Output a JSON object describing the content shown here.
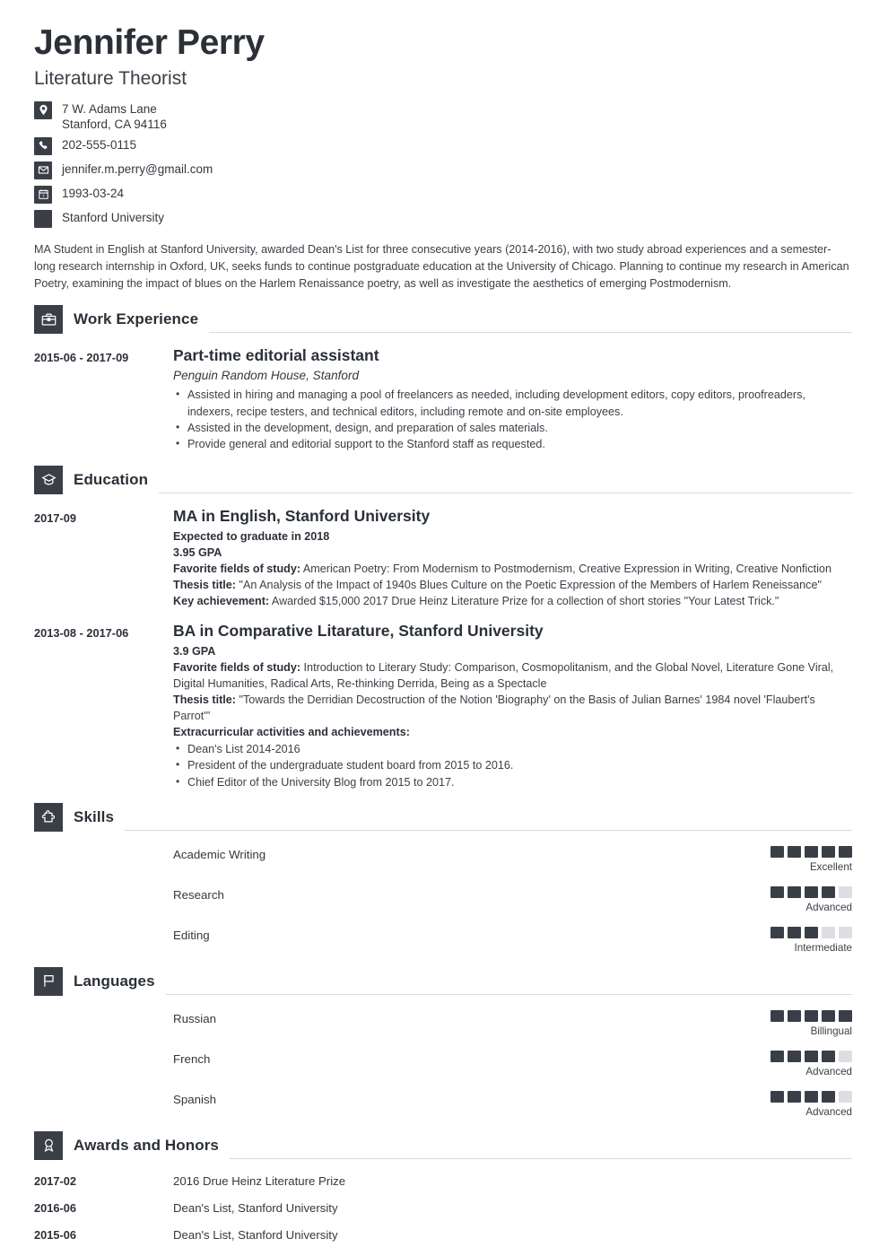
{
  "header": {
    "name": "Jennifer Perry",
    "job_title": "Literature Theorist",
    "contacts": [
      {
        "icon": "location-pin-icon",
        "line1": "7 W. Adams Lane",
        "line2": "Stanford, CA 94116"
      },
      {
        "icon": "phone-icon",
        "line1": "202-555-0115",
        "line2": ""
      },
      {
        "icon": "envelope-icon",
        "line1": "jennifer.m.perry@gmail.com",
        "line2": ""
      },
      {
        "icon": "calendar-icon",
        "line1": "1993-03-24",
        "line2": ""
      },
      {
        "icon": "square-icon",
        "line1": "Stanford University",
        "line2": ""
      }
    ]
  },
  "summary": "MA Student in English at Stanford University, awarded Dean's List for three consecutive years (2014-2016), with two study abroad experiences and a semester-long research internship in Oxford, UK, seeks funds to continue postgraduate education at the University of Chicago. Planning to continue my research in American Poetry, examining the impact of blues on the Harlem Renaissance poetry, as well as investigate the aesthetics of emerging Postmodernism.",
  "sections": {
    "work": {
      "title": "Work Experience",
      "icon": "briefcase-icon",
      "entries": [
        {
          "date": "2015-06 - 2017-09",
          "title": "Part-time editorial assistant",
          "subtitle": "Penguin Random House, Stanford",
          "bullets": [
            "Assisted in hiring and managing a pool of freelancers as needed, including development editors, copy editors, proofreaders, indexers, recipe testers, and technical editors, including remote and on-site employees.",
            "Assisted in the development, design, and preparation of sales materials.",
            "Provide general and editorial support to the Stanford staff as requested."
          ]
        }
      ]
    },
    "education": {
      "title": "Education",
      "icon": "graduation-cap-icon",
      "entries": [
        {
          "date": "2017-09",
          "title": "MA in English, Stanford University",
          "bold_lines": [
            "Expected to graduate in 2018",
            "3.95 GPA"
          ],
          "details": [
            {
              "label": "Favorite fields of study:",
              "text": " American Poetry: From Modernism to Postmodernism, Creative Expression in Writing, Creative Nonfiction"
            },
            {
              "label": "Thesis title:",
              "text": " \"An Analysis of the Impact of 1940s Blues Culture on the Poetic Expression of the Members of Harlem Reneissance\""
            },
            {
              "label": "Key achievement:",
              "text": " Awarded $15,000 2017 Drue Heinz Literature Prize for a collection of short stories \"Your Latest Trick.\""
            }
          ],
          "bullets_heading": "",
          "bullets": []
        },
        {
          "date": "2013-08 - 2017-06",
          "title": "BA in Comparative Litarature, Stanford University",
          "bold_lines": [
            "3.9 GPA"
          ],
          "details": [
            {
              "label": "Favorite fields of study:",
              "text": " Introduction to Literary Study: Comparison, Cosmopolitanism, and the Global Novel, Literature Gone Viral, Digital Humanities, Radical Arts, Re-thinking Derrida, Being as a Spectacle"
            },
            {
              "label": "Thesis title:",
              "text": " \"Towards the Derridian Decostruction of the Notion 'Biography' on the Basis of Julian Barnes' 1984 novel 'Flaubert's Parrot'\""
            }
          ],
          "bullets_heading": "Extracurricular activities and achievements:",
          "bullets": [
            "Dean's List 2014-2016",
            "President of the undergraduate student board from 2015 to 2016.",
            "Chief Editor of the University Blog from 2015 to 2017."
          ]
        }
      ]
    },
    "skills": {
      "title": "Skills",
      "icon": "puzzle-piece-icon",
      "max_rating": 5,
      "items": [
        {
          "name": "Academic Writing",
          "rating": 5,
          "level": "Excellent"
        },
        {
          "name": "Research",
          "rating": 4,
          "level": "Advanced"
        },
        {
          "name": "Editing",
          "rating": 3,
          "level": "Intermediate"
        }
      ]
    },
    "languages": {
      "title": "Languages",
      "icon": "flag-icon",
      "max_rating": 5,
      "items": [
        {
          "name": "Russian",
          "rating": 5,
          "level": "Billingual"
        },
        {
          "name": "French",
          "rating": 4,
          "level": "Advanced"
        },
        {
          "name": "Spanish",
          "rating": 4,
          "level": "Advanced"
        }
      ]
    },
    "awards": {
      "title": "Awards and Honors",
      "icon": "award-ribbon-icon",
      "items": [
        {
          "date": "2017-02",
          "text": "2016 Drue Heinz Literature Prize"
        },
        {
          "date": "2016-06",
          "text": "Dean's List, Stanford University"
        },
        {
          "date": "2015-06",
          "text": "Dean's List, Stanford University"
        }
      ]
    }
  },
  "colors": {
    "badge": "#3a3f47",
    "text": "#33383f",
    "heading": "#2b3038",
    "rule": "#d8dade",
    "dot_off": "#dcdee1"
  }
}
